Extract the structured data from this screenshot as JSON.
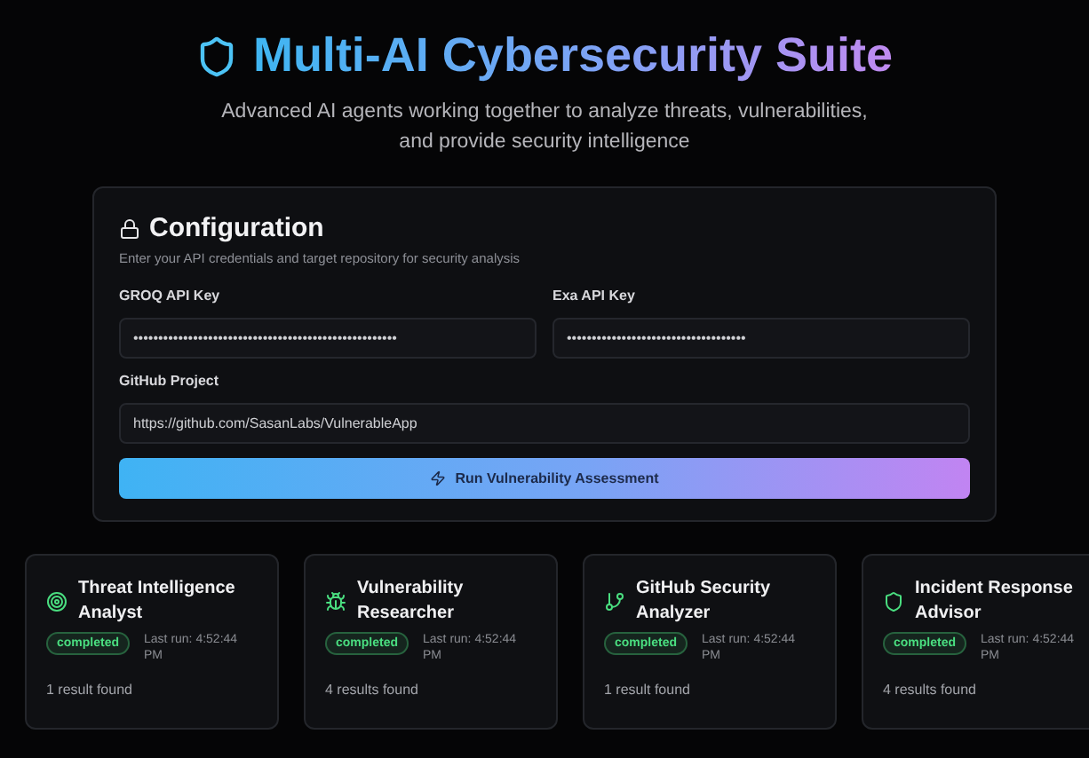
{
  "header": {
    "title": "Multi-AI Cybersecurity Suite",
    "subtitle": "Advanced AI agents working together to analyze threats, vulnerabilities, and provide security intelligence"
  },
  "configuration": {
    "title": "Configuration",
    "description": "Enter your API credentials and target repository for security analysis",
    "fields": [
      {
        "label": "GROQ API Key",
        "value": "•••••••••••••••••••••••••••••••••••••••••••••••••••••"
      },
      {
        "label": "Exa API Key",
        "value": "••••••••••••••••••••••••••••••••••••"
      },
      {
        "label": "GitHub Project",
        "value": "https://github.com/SasanLabs/VulnerableApp"
      }
    ],
    "button": "Run Vulnerability Assessment"
  },
  "agents": [
    {
      "kind": "target",
      "name": "Threat Intelligence Analyst",
      "status": "completed",
      "last_run": "Last run: 4:52:44 PM",
      "results": "1 result found"
    },
    {
      "kind": "bug",
      "name": "Vulnerability Researcher",
      "status": "completed",
      "last_run": "Last run: 4:52:44 PM",
      "results": "4 results found"
    },
    {
      "kind": "branch",
      "name": "GitHub Security Analyzer",
      "status": "completed",
      "last_run": "Last run: 4:52:44 PM",
      "results": "1 result found"
    },
    {
      "kind": "shield",
      "name": "Incident Response Advisor",
      "status": "completed",
      "last_run": "Last run: 4:52:44 PM",
      "results": "4 results found"
    }
  ]
}
